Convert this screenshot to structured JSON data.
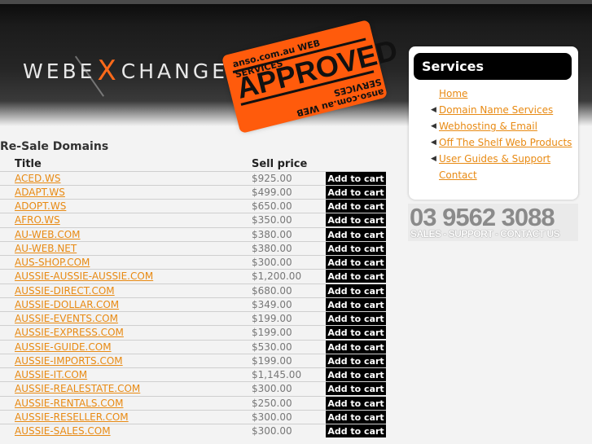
{
  "header": {
    "logo_left": "WEBE",
    "logo_x": "X",
    "logo_right": "CHANGE",
    "stamp": {
      "top": "anso.com.au WEB SERVICES",
      "main": "APPROVED",
      "bottom": "anso.com.au WEB SERVICES"
    }
  },
  "main": {
    "title": "Re-Sale Domains",
    "columns": {
      "title": "Title",
      "price": "Sell price"
    },
    "cart_label": "Add to cart",
    "rows": [
      {
        "name": "ACED.WS",
        "price": "$925.00"
      },
      {
        "name": "ADAPT.WS",
        "price": "$499.00"
      },
      {
        "name": "ADOPT.WS",
        "price": "$650.00"
      },
      {
        "name": "AFRO.WS",
        "price": "$350.00"
      },
      {
        "name": "AU-WEB.COM",
        "price": "$380.00"
      },
      {
        "name": "AU-WEB.NET",
        "price": "$380.00"
      },
      {
        "name": "AUS-SHOP.COM",
        "price": "$300.00"
      },
      {
        "name": "AUSSIE-AUSSIE-AUSSIE.COM",
        "price": "$1,200.00"
      },
      {
        "name": "AUSSIE-DIRECT.COM",
        "price": "$680.00"
      },
      {
        "name": "AUSSIE-DOLLAR.COM",
        "price": "$349.00"
      },
      {
        "name": "AUSSIE-EVENTS.COM",
        "price": "$199.00"
      },
      {
        "name": "AUSSIE-EXPRESS.COM",
        "price": "$199.00"
      },
      {
        "name": "AUSSIE-GUIDE.COM",
        "price": "$530.00"
      },
      {
        "name": "AUSSIE-IMPORTS.COM",
        "price": "$199.00"
      },
      {
        "name": "AUSSIE-IT.COM",
        "price": "$1,145.00"
      },
      {
        "name": "AUSSIE-REALESTATE.COM",
        "price": "$300.00"
      },
      {
        "name": "AUSSIE-RENTALS.COM",
        "price": "$250.00"
      },
      {
        "name": "AUSSIE-RESELLER.COM",
        "price": "$300.00"
      },
      {
        "name": "AUSSIE-SALES.COM",
        "price": "$300.00"
      }
    ]
  },
  "services": {
    "title": "Services",
    "items": [
      {
        "label": "Home",
        "arrow": false
      },
      {
        "label": "Domain Name Services",
        "arrow": true
      },
      {
        "label": "Webhosting & Email",
        "arrow": true
      },
      {
        "label": "Off The Shelf Web Products",
        "arrow": true
      },
      {
        "label": "User Guides & Support",
        "arrow": true
      },
      {
        "label": "Contact",
        "arrow": false
      }
    ]
  },
  "phone": {
    "number": "03 9562 3088",
    "subtitle": "SALES - SUPPORT - CONTACT US"
  },
  "colors": {
    "link": "#e88a13",
    "accent": "#ff5b0c",
    "button_bg": "#000000"
  }
}
